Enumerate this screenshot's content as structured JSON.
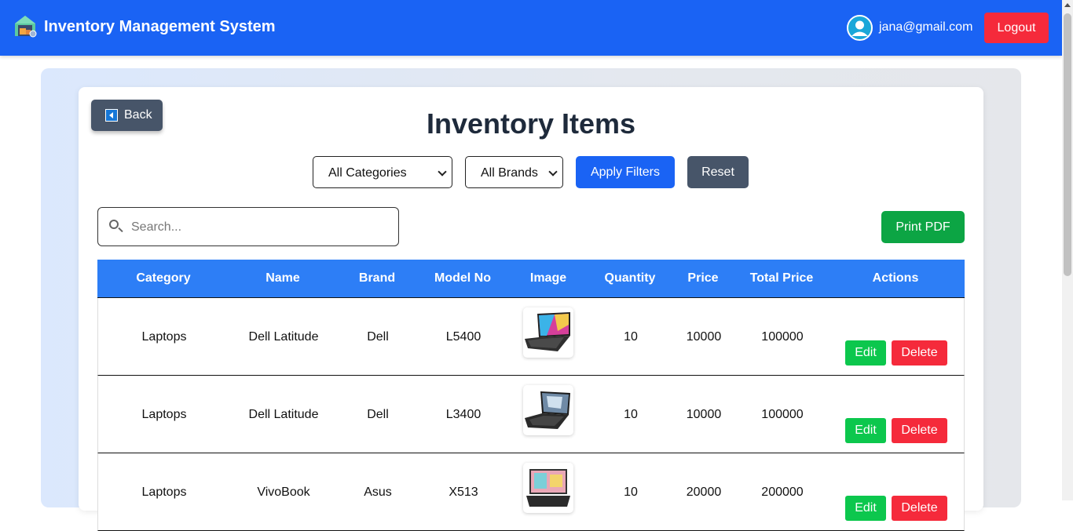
{
  "header": {
    "app_title": "Inventory Management System",
    "user_email": "jana@gmail.com",
    "logout_label": "Logout",
    "brand_color": "#1a63f4"
  },
  "page": {
    "back_label": "Back",
    "title": "Inventory Items",
    "filters": {
      "category_selected": "All Categories",
      "brand_selected": "All Brands",
      "apply_label": "Apply Filters",
      "reset_label": "Reset"
    },
    "search": {
      "placeholder": "Search...",
      "value": ""
    },
    "print_label": "Print PDF"
  },
  "table": {
    "headers": [
      "Category",
      "Name",
      "Brand",
      "Model No",
      "Image",
      "Quantity",
      "Price",
      "Total Price",
      "Actions"
    ],
    "rows": [
      {
        "category": "Laptops",
        "name": "Dell Latitude",
        "brand": "Dell",
        "model": "L5400",
        "image": "laptop-image",
        "quantity": "10",
        "price": "10000",
        "total": "100000",
        "edit": "Edit",
        "delete": "Delete"
      },
      {
        "category": "Laptops",
        "name": "Dell Latitude",
        "brand": "Dell",
        "model": "L3400",
        "image": "laptop-image",
        "quantity": "10",
        "price": "10000",
        "total": "100000",
        "edit": "Edit",
        "delete": "Delete"
      },
      {
        "category": "Laptops",
        "name": "VivoBook",
        "brand": "Asus",
        "model": "X513",
        "image": "laptop-image",
        "quantity": "10",
        "price": "20000",
        "total": "200000",
        "edit": "Edit",
        "delete": "Delete"
      }
    ]
  }
}
